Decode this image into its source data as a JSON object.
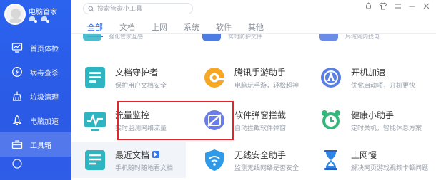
{
  "sidebar": {
    "profile_name": "电脑管家",
    "items": [
      {
        "label": "首页体检",
        "icon": "monitor-icon"
      },
      {
        "label": "病毒查杀",
        "icon": "lightning-icon"
      },
      {
        "label": "垃圾清理",
        "icon": "broom-icon"
      },
      {
        "label": "电脑加速",
        "icon": "rocket-icon"
      },
      {
        "label": "工具箱",
        "icon": "toolbox-icon",
        "active": true
      }
    ]
  },
  "search": {
    "placeholder": "搜索管家小工具"
  },
  "tabs": [
    "全部",
    "文档",
    "上网",
    "系统",
    "软件",
    "其他"
  ],
  "clipped_row": [
    "强化管家互感",
    "实时防护文件",
    "局域网内找电"
  ],
  "tools": [
    {
      "name": "文档守护者",
      "desc": "保护用户文档安全",
      "icon": "document-guard-icon"
    },
    {
      "name": "腾讯手游助手",
      "desc": "电脑玩手游，轻松超神",
      "icon": "game-assistant-icon"
    },
    {
      "name": "开机加速",
      "desc": "优化启动项，开机更快",
      "icon": "boot-speedup-icon"
    },
    {
      "name": "流量监控",
      "desc": "实时监测网络流量",
      "icon": "traffic-monitor-icon"
    },
    {
      "name": "软件弹窗拦截",
      "desc": "自动拦截软件弹窗",
      "icon": "popup-block-icon"
    },
    {
      "name": "健康小助手",
      "desc": "定时关机，智能休息方案",
      "icon": "alarm-clock-icon"
    },
    {
      "name": "最近文档",
      "desc": "手机随时随地看文档",
      "icon": "recent-docs-icon",
      "badge": true
    },
    {
      "name": "无线安全助手",
      "desc": "监测无线网络是否安全",
      "icon": "wifi-shield-icon"
    },
    {
      "name": "上网慢",
      "desc": "解决网页游戏视频卡顿问题",
      "icon": "hourglass-icon"
    }
  ],
  "colors": {
    "sidebar": "#2b63ee",
    "accent": "#2b63ee",
    "highlight": "#e4242b"
  }
}
